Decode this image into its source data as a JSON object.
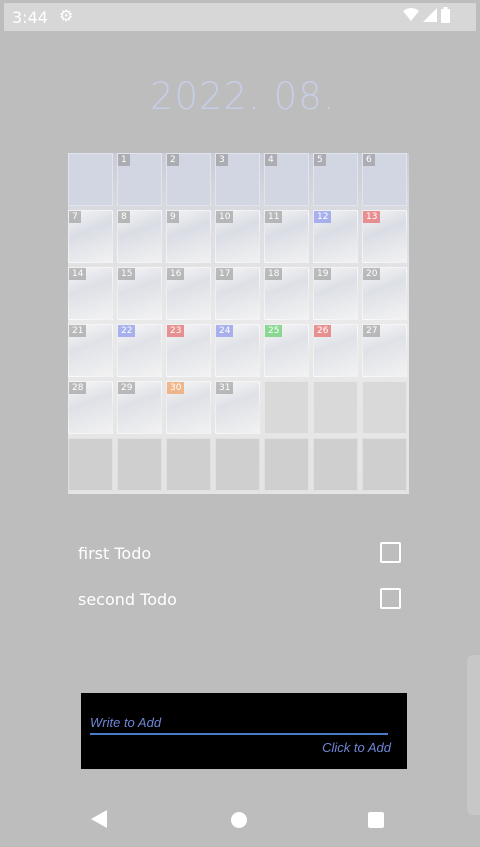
{
  "status_bar": {
    "time": "3:44",
    "icons": [
      "gear-icon",
      "wifi-icon",
      "signal-icon",
      "battery-icon"
    ]
  },
  "calendar": {
    "title": "2022. 08.",
    "days": [
      {
        "label": "",
        "tone": "plain"
      },
      {
        "label": "1",
        "tone": "plain"
      },
      {
        "label": "2",
        "tone": "plain"
      },
      {
        "label": "3",
        "tone": "plain"
      },
      {
        "label": "4",
        "tone": "plain"
      },
      {
        "label": "5",
        "tone": "plain"
      },
      {
        "label": "6",
        "tone": "plain"
      },
      {
        "label": "7",
        "tone": "plain"
      },
      {
        "label": "8",
        "tone": "plain"
      },
      {
        "label": "9",
        "tone": "plain"
      },
      {
        "label": "10",
        "tone": "plain"
      },
      {
        "label": "11",
        "tone": "plain"
      },
      {
        "label": "12",
        "tone": "blue"
      },
      {
        "label": "13",
        "tone": "red"
      },
      {
        "label": "14",
        "tone": "plain"
      },
      {
        "label": "15",
        "tone": "plain"
      },
      {
        "label": "16",
        "tone": "plain"
      },
      {
        "label": "17",
        "tone": "plain"
      },
      {
        "label": "18",
        "tone": "plain"
      },
      {
        "label": "19",
        "tone": "plain"
      },
      {
        "label": "20",
        "tone": "plain"
      },
      {
        "label": "21",
        "tone": "plain"
      },
      {
        "label": "22",
        "tone": "blue"
      },
      {
        "label": "23",
        "tone": "red"
      },
      {
        "label": "24",
        "tone": "blue"
      },
      {
        "label": "25",
        "tone": "green"
      },
      {
        "label": "26",
        "tone": "red"
      },
      {
        "label": "27",
        "tone": "plain"
      },
      {
        "label": "28",
        "tone": "plain"
      },
      {
        "label": "29",
        "tone": "plain"
      },
      {
        "label": "30",
        "tone": "orange"
      },
      {
        "label": "31",
        "tone": "plain"
      },
      {
        "label": "",
        "tone": "plain"
      },
      {
        "label": "",
        "tone": "plain"
      },
      {
        "label": "",
        "tone": "plain"
      },
      {
        "label": "",
        "tone": "plain"
      },
      {
        "label": "",
        "tone": "plain"
      },
      {
        "label": "",
        "tone": "plain"
      },
      {
        "label": "",
        "tone": "plain"
      },
      {
        "label": "",
        "tone": "plain"
      },
      {
        "label": "",
        "tone": "plain"
      },
      {
        "label": "",
        "tone": "plain"
      }
    ]
  },
  "todos": [
    {
      "label": "first Todo",
      "checked": false
    },
    {
      "label": "second Todo",
      "checked": false
    }
  ],
  "add_panel": {
    "placeholder": "Write to Add",
    "button_label": "Click to Add"
  },
  "navigation": {
    "icons": [
      "back-icon",
      "home-icon",
      "recent-apps-icon"
    ]
  }
}
